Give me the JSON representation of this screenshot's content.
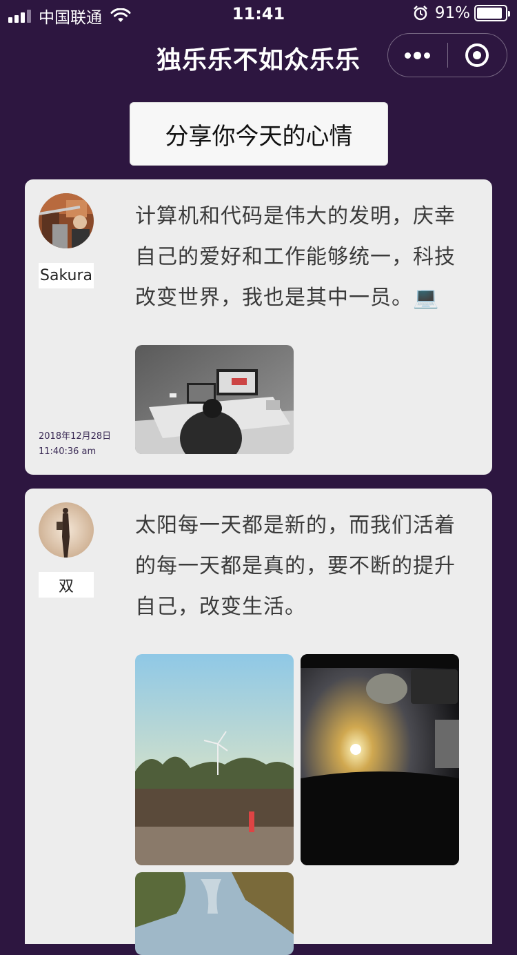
{
  "status_bar": {
    "carrier": "中国联通",
    "time": "11:41",
    "battery": "91%",
    "battery_level": 0.91
  },
  "nav": {
    "title": "独乐乐不如众乐乐"
  },
  "share_button": "分享你今天的心情",
  "posts": [
    {
      "username": "Sakura",
      "content": "计算机和代码是伟大的发明，庆幸自己的爱好和工作能够统一，科技改变世界，我也是其中一员。💻",
      "date": "2018年12月28日",
      "time": "11:40:36 am"
    },
    {
      "username": "双",
      "content": "太阳每一天都是新的，而我们活着的每一天都是真的，要不断的提升自己，改变生活。"
    }
  ]
}
